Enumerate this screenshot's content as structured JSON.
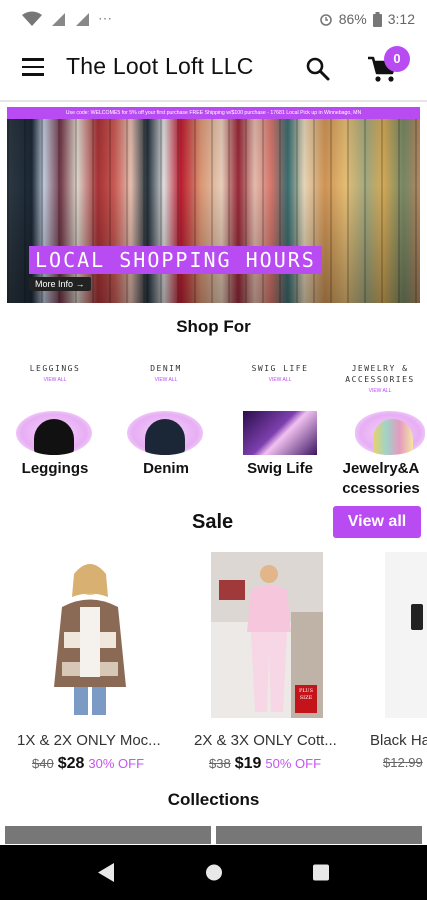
{
  "status": {
    "battery": "86%",
    "time": "3:12"
  },
  "appbar": {
    "title": "The Loot Loft LLC",
    "cart_count": "0"
  },
  "hero": {
    "promo_text": "Use code: WELCOME5 for 5% off your first purchase  FREE Shipping w/$100 purchase - 17681 Local Pick up in Winnebago, MN",
    "title": "LOCAL SHOPPING HOURS",
    "more_label": "More Info →"
  },
  "shop_for": {
    "heading": "Shop For",
    "categories": [
      {
        "top": "LEGGINGS",
        "sub": "VIEW ALL",
        "label": "Leggings"
      },
      {
        "top": "DENIM",
        "sub": "VIEW ALL",
        "label": "Denim"
      },
      {
        "top": "SWIG LIFE",
        "sub": "VIEW ALL",
        "label": "Swig Life"
      },
      {
        "top": "JEWELRY & ACCESSORIES",
        "sub": "VIEW ALL",
        "label": "Jewelry&Accessories"
      }
    ]
  },
  "sale": {
    "heading": "Sale",
    "view_all_label": "View all",
    "products": [
      {
        "name": "1X & 2X ONLY Moc...",
        "old_price": "$40",
        "price": "$28",
        "discount": "30% OFF"
      },
      {
        "name": "2X & 3X ONLY Cott...",
        "old_price": "$38",
        "price": "$19",
        "discount": "50% OFF",
        "tag": "PLUS SIZE"
      },
      {
        "name": "Black Ha",
        "old_price": "$12.99"
      }
    ]
  },
  "collections": {
    "heading": "Collections"
  },
  "colors": {
    "accent": "#b84bf2"
  },
  "icons": {
    "menu": "menu-icon",
    "search": "search-icon",
    "cart": "cart-icon",
    "back": "back-icon",
    "home": "home-icon",
    "recents": "recents-icon"
  }
}
